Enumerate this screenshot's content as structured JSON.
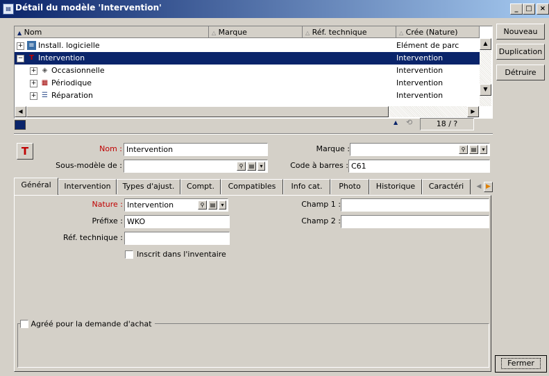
{
  "window": {
    "title": "Détail du modèle 'Intervention'",
    "controls": [
      "_",
      "□",
      "×"
    ]
  },
  "list": {
    "columns": [
      "Nom",
      "Marque",
      "Réf. technique",
      "Crée (Nature)"
    ],
    "rows": [
      {
        "name": "Install. logicielle",
        "nature": "Elément de parc",
        "expand": "+"
      },
      {
        "name": "Intervention",
        "nature": "Intervention",
        "expand": "−"
      },
      {
        "name": "Occasionnelle",
        "nature": "Intervention",
        "expand": "+"
      },
      {
        "name": "Périodique",
        "nature": "Intervention",
        "expand": "+"
      },
      {
        "name": "Réparation",
        "nature": "Intervention",
        "expand": "+"
      }
    ],
    "counter": "18 / ?"
  },
  "side_buttons": {
    "new": "Nouveau",
    "duplicate": "Duplication",
    "destroy": "Détruire",
    "close": "Fermer"
  },
  "form": {
    "nom_label": "Nom :",
    "nom_value": "Intervention",
    "marque_label": "Marque :",
    "marque_value": "",
    "sous_modele_label": "Sous-modèle de :",
    "sous_modele_value": "",
    "code_barres_label": "Code à barres :",
    "code_barres_value": "C61"
  },
  "tabs": [
    "Général",
    "Intervention",
    "Types d'ajust.",
    "Compt.",
    "Compatibles",
    "Info cat.",
    "Photo",
    "Historique",
    "Caractéri"
  ],
  "general": {
    "nature_label": "Nature :",
    "nature_value": "Intervention",
    "prefixe_label": "Préfixe :",
    "prefixe_value": "WKO",
    "ref_tech_label": "Réf. technique :",
    "ref_tech_value": "",
    "inventaire_label": "Inscrit dans l'inventaire",
    "champ1_label": "Champ 1 :",
    "champ1_value": "",
    "champ2_label": "Champ 2 :",
    "champ2_value": "",
    "agree_label": "Agréé pour la demande d'achat"
  },
  "colors": {
    "title_start": "#0a246a",
    "selection": "#0a246a",
    "mandatory": "#c00000"
  }
}
